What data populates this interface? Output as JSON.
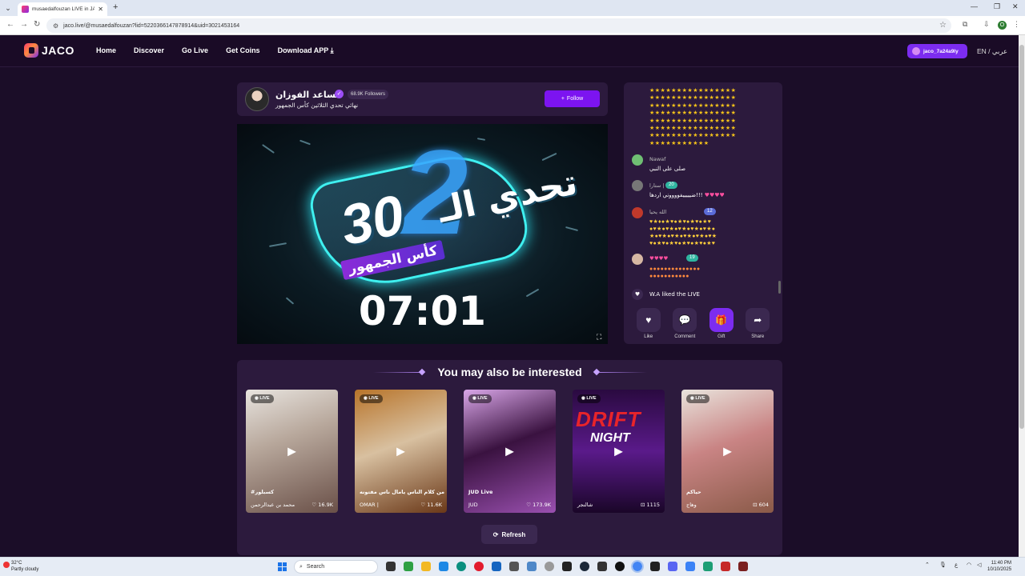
{
  "browser": {
    "tab_title": "musaedalfouzan LIVE in JACO",
    "url": "jaco.live/@musaedalfouzan?lid=5220366147878914&uid=3021453164",
    "profile_initial": "O"
  },
  "header": {
    "logo_text": "JACO",
    "nav": [
      "Home",
      "Discover",
      "Go Live",
      "Get Coins",
      "Download APP"
    ],
    "user_name": "jaco_7a24a9ly",
    "lang": "EN / عربي"
  },
  "streamer": {
    "name": "مساعد الفوزان",
    "followers": "68.9K Followers",
    "subtitle": "نهائي تحدي الثلاثين كأس الجمهور",
    "follow_label": "Follow"
  },
  "video": {
    "title_ar": "تحدي الـ",
    "number": "30",
    "big_digit": "2",
    "cup_label": "كأس الجمهور",
    "timer": "07:01"
  },
  "chat": {
    "messages": [
      {
        "name": "Nawaf",
        "text": "صلى على النبي"
      },
      {
        "name": "ستارا |",
        "text": "ضيييييفووووني اردها!!!",
        "level": "20"
      },
      {
        "name": "الله يحيا",
        "text": "",
        "level": "12"
      },
      {
        "name": "",
        "text": "",
        "level": "19"
      }
    ],
    "liked_text": "W.A liked the LIVE",
    "actions": [
      "Like",
      "Comment",
      "Gift",
      "Share"
    ]
  },
  "recommendations": {
    "title": "You may also be interested",
    "badge": "LIVE",
    "cards": [
      {
        "title": "#كسبلور",
        "user": "محمد بن عبدالرحمن",
        "count": "16.9K"
      },
      {
        "title": "من كلام الناس يامال ناس مفتونه",
        "user": "OMAR |",
        "count": "11.6K"
      },
      {
        "title": "JUD Live",
        "user": "JUD",
        "count": "173.9K"
      },
      {
        "title": "",
        "user": "شالنجر",
        "count": "1115"
      },
      {
        "title": "حياكم",
        "user": "وهاج",
        "count": "604"
      }
    ],
    "drift_top": "DRIFT",
    "drift_bottom": "NIGHT",
    "refresh_label": "Refresh"
  },
  "taskbar": {
    "temp": "32°C",
    "weather": "Partly cloudy",
    "search": "Search",
    "time": "11:40 PM",
    "date": "10/10/2025"
  }
}
